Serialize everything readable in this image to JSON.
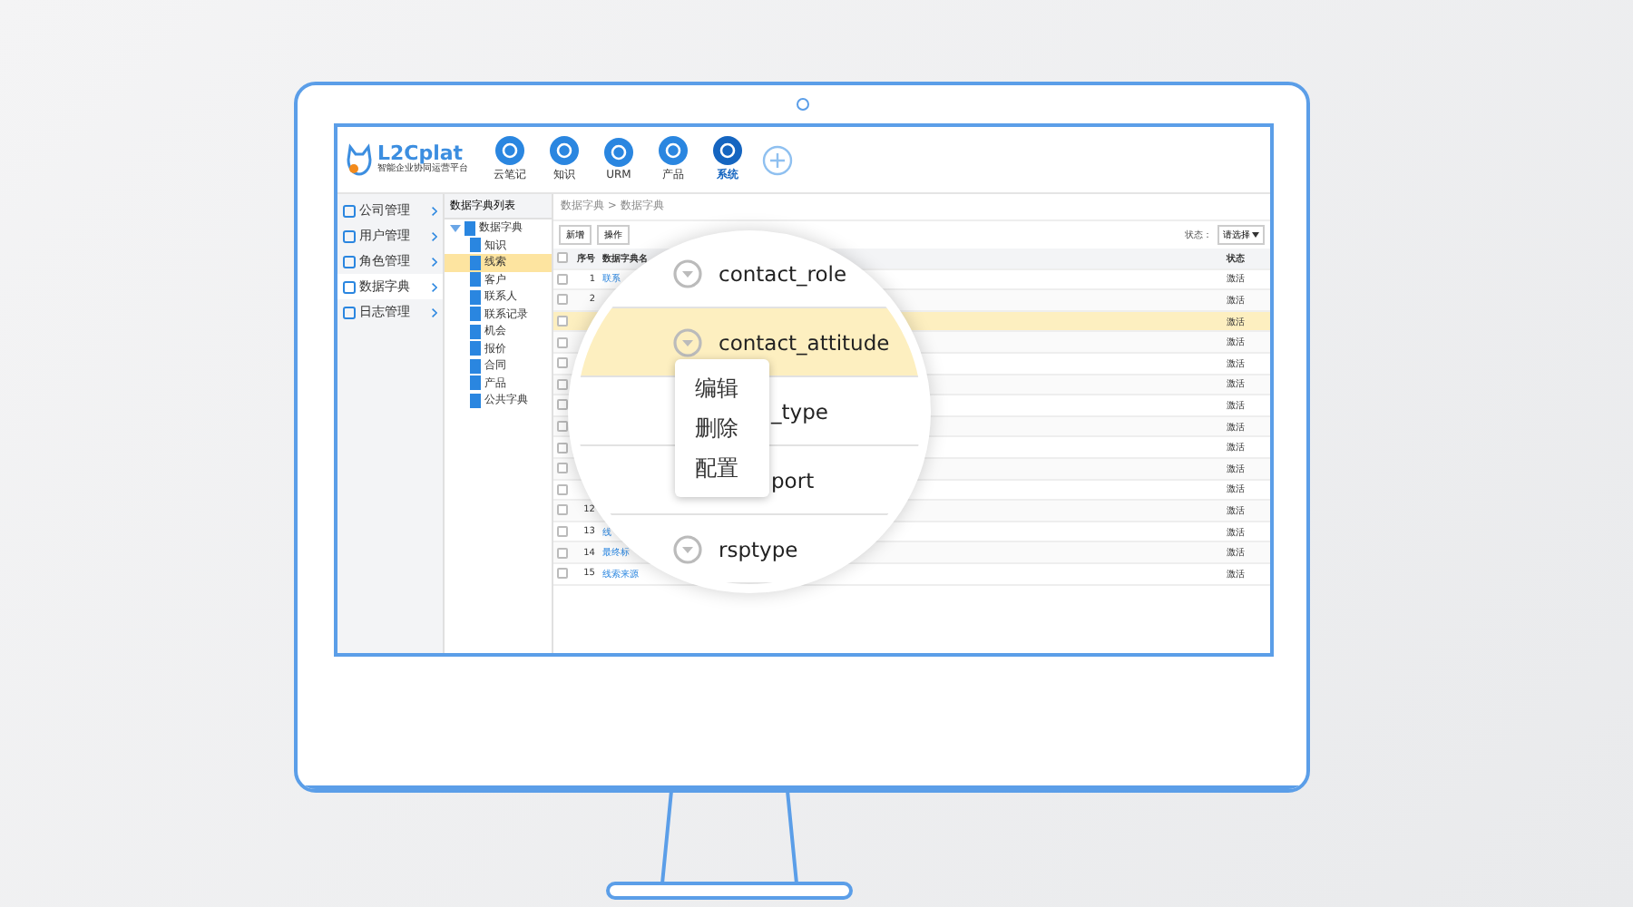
{
  "logo": {
    "name": "L2Cplat",
    "tagline": "智能企业协同运营平台"
  },
  "nav": [
    {
      "label": "云笔记",
      "selected": false
    },
    {
      "label": "知识",
      "selected": false
    },
    {
      "label": "URM",
      "selected": false
    },
    {
      "label": "产品",
      "selected": false
    },
    {
      "label": "系统",
      "selected": true
    }
  ],
  "sidebar": [
    {
      "label": "公司管理",
      "selected": false
    },
    {
      "label": "用户管理",
      "selected": false
    },
    {
      "label": "角色管理",
      "selected": false
    },
    {
      "label": "数据字典",
      "selected": true
    },
    {
      "label": "日志管理",
      "selected": false
    }
  ],
  "tree": {
    "title": "数据字典列表",
    "root": {
      "label": "数据字典",
      "expanded": true,
      "children": [
        {
          "label": "知识",
          "selected": false
        },
        {
          "label": "线索",
          "selected": true
        },
        {
          "label": "客户",
          "selected": false
        },
        {
          "label": "联系人",
          "selected": false
        },
        {
          "label": "联系记录",
          "selected": false
        },
        {
          "label": "机会",
          "selected": false
        },
        {
          "label": "报价",
          "selected": false
        },
        {
          "label": "合同",
          "selected": false
        },
        {
          "label": "产品",
          "selected": false
        },
        {
          "label": "公共字典",
          "selected": false
        }
      ]
    }
  },
  "breadcrumb": "数据字典 > 数据字典",
  "toolbar": {
    "buttons": [
      "新增",
      "操作"
    ],
    "filter_label": "状态：",
    "filter_value": "请选择"
  },
  "table": {
    "columns": [
      "序号",
      "数据字典名",
      "状态"
    ],
    "all_checked": false,
    "rows": [
      {
        "number": "1",
        "name": "联系",
        "status": "激活",
        "checked": false,
        "selected": false
      },
      {
        "number": "2",
        "status": "激活",
        "checked": false,
        "selected": false
      },
      {
        "status": "激活",
        "checked": false,
        "selected": true
      },
      {
        "status": "激活",
        "checked": false,
        "selected": false
      },
      {
        "status": "激活",
        "checked": false,
        "selected": false
      },
      {
        "status": "激活",
        "checked": false,
        "selected": false
      },
      {
        "status": "激活",
        "checked": false,
        "selected": false
      },
      {
        "status": "激活",
        "checked": false,
        "selected": false
      },
      {
        "status": "激活",
        "checked": false,
        "selected": false
      },
      {
        "status": "激活",
        "checked": false,
        "selected": false
      },
      {
        "status": "激活",
        "checked": false,
        "selected": false
      },
      {
        "number": "12",
        "status": "激活",
        "checked": false,
        "selected": false
      },
      {
        "number": "13",
        "name": "线",
        "status": "激活",
        "checked": false,
        "selected": false
      },
      {
        "number": "14",
        "name": "最终标",
        "status": "激活",
        "checked": false,
        "selected": false
      },
      {
        "number": "15",
        "name": "线索来源",
        "status": "激活",
        "checked": false,
        "selected": false
      }
    ]
  },
  "magnifier": {
    "rows": [
      {
        "text": "contact_role",
        "kind": "full",
        "selected": false
      },
      {
        "text": "contact_attitude",
        "kind": "full",
        "selected": true
      },
      {
        "text": "_type",
        "kind": "covered",
        "selected": false
      },
      {
        "text": "port",
        "kind": "covered",
        "selected": false
      },
      {
        "text": "rsptype",
        "kind": "full",
        "selected": false
      }
    ],
    "menu": [
      "编辑",
      "删除",
      "配置"
    ]
  }
}
